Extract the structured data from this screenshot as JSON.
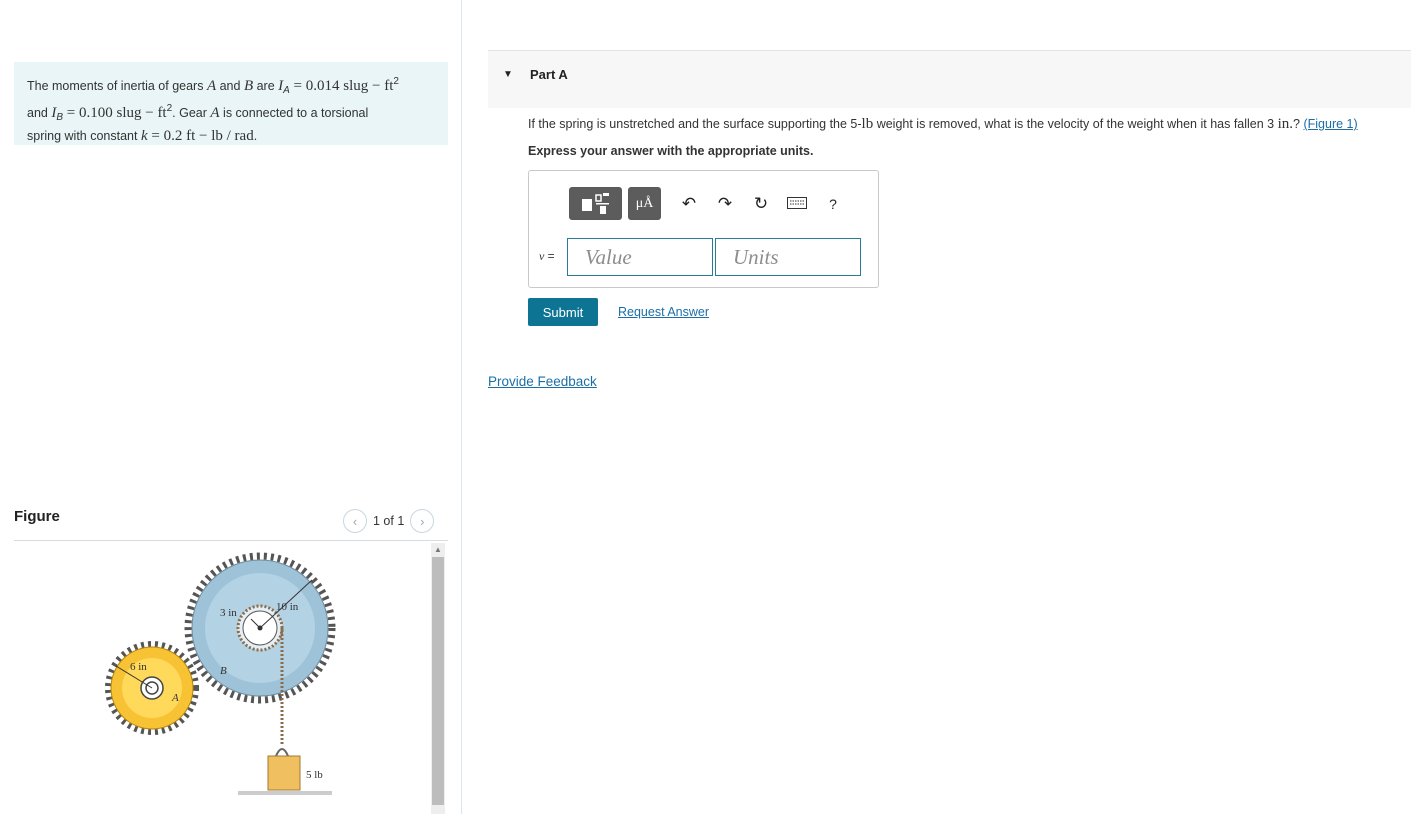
{
  "problem": {
    "t1": "The moments of inertia of gears ",
    "A": "A",
    "t2": " and ",
    "B": "B",
    "t3": " are ",
    "IA_sym": "I",
    "IA_sub": "A",
    "IA_val": " = 0.014 slug − ft",
    "exp2": "2",
    "t4": "and ",
    "IB_sym": "I",
    "IB_sub": "B",
    "IB_val": " = 0.100 slug − ft",
    "t5": ". Gear ",
    "t6": " is connected to a torsional",
    "t7": "spring with constant ",
    "k": "k",
    "k_val": " = 0.2 ft − lb / rad",
    "t8": "."
  },
  "figure": {
    "title": "Figure",
    "pager": "1 of 1",
    "prev_icon": "chevron-left-icon",
    "next_icon": "chevron-right-icon",
    "labels": {
      "r_small": "3 in",
      "r_big": "10 in",
      "r_A": "6 in",
      "gear_A": "A",
      "gear_B": "B",
      "weight": "5 lb"
    }
  },
  "part": {
    "title": "Part A",
    "q1": "If the spring is unstretched and the surface supporting the 5-",
    "q_lb": "lb",
    "q2": " weight is removed, what is the velocity of the weight when it has fallen 3 ",
    "q_in": "in.",
    "q3": "? ",
    "q_link": "(Figure 1)",
    "instruction": "Express your answer with the appropriate units.",
    "toolbar": {
      "mu_label": "μÅ",
      "undo_icon": "undo-icon",
      "redo_icon": "redo-icon",
      "reset_icon": "reset-icon",
      "keyboard_icon": "keyboard-icon",
      "help": "?"
    },
    "var_label": "v",
    "eq": " =",
    "value_placeholder": "Value",
    "units_placeholder": "Units",
    "submit": "Submit",
    "request": "Request Answer"
  },
  "feedback": "Provide Feedback",
  "colors": {
    "accent": "#0e7494",
    "link": "#1b6fa6",
    "problem_bg": "#e9f5f7",
    "gear_A": "#f7c233",
    "gear_B": "#9ec3d9"
  }
}
